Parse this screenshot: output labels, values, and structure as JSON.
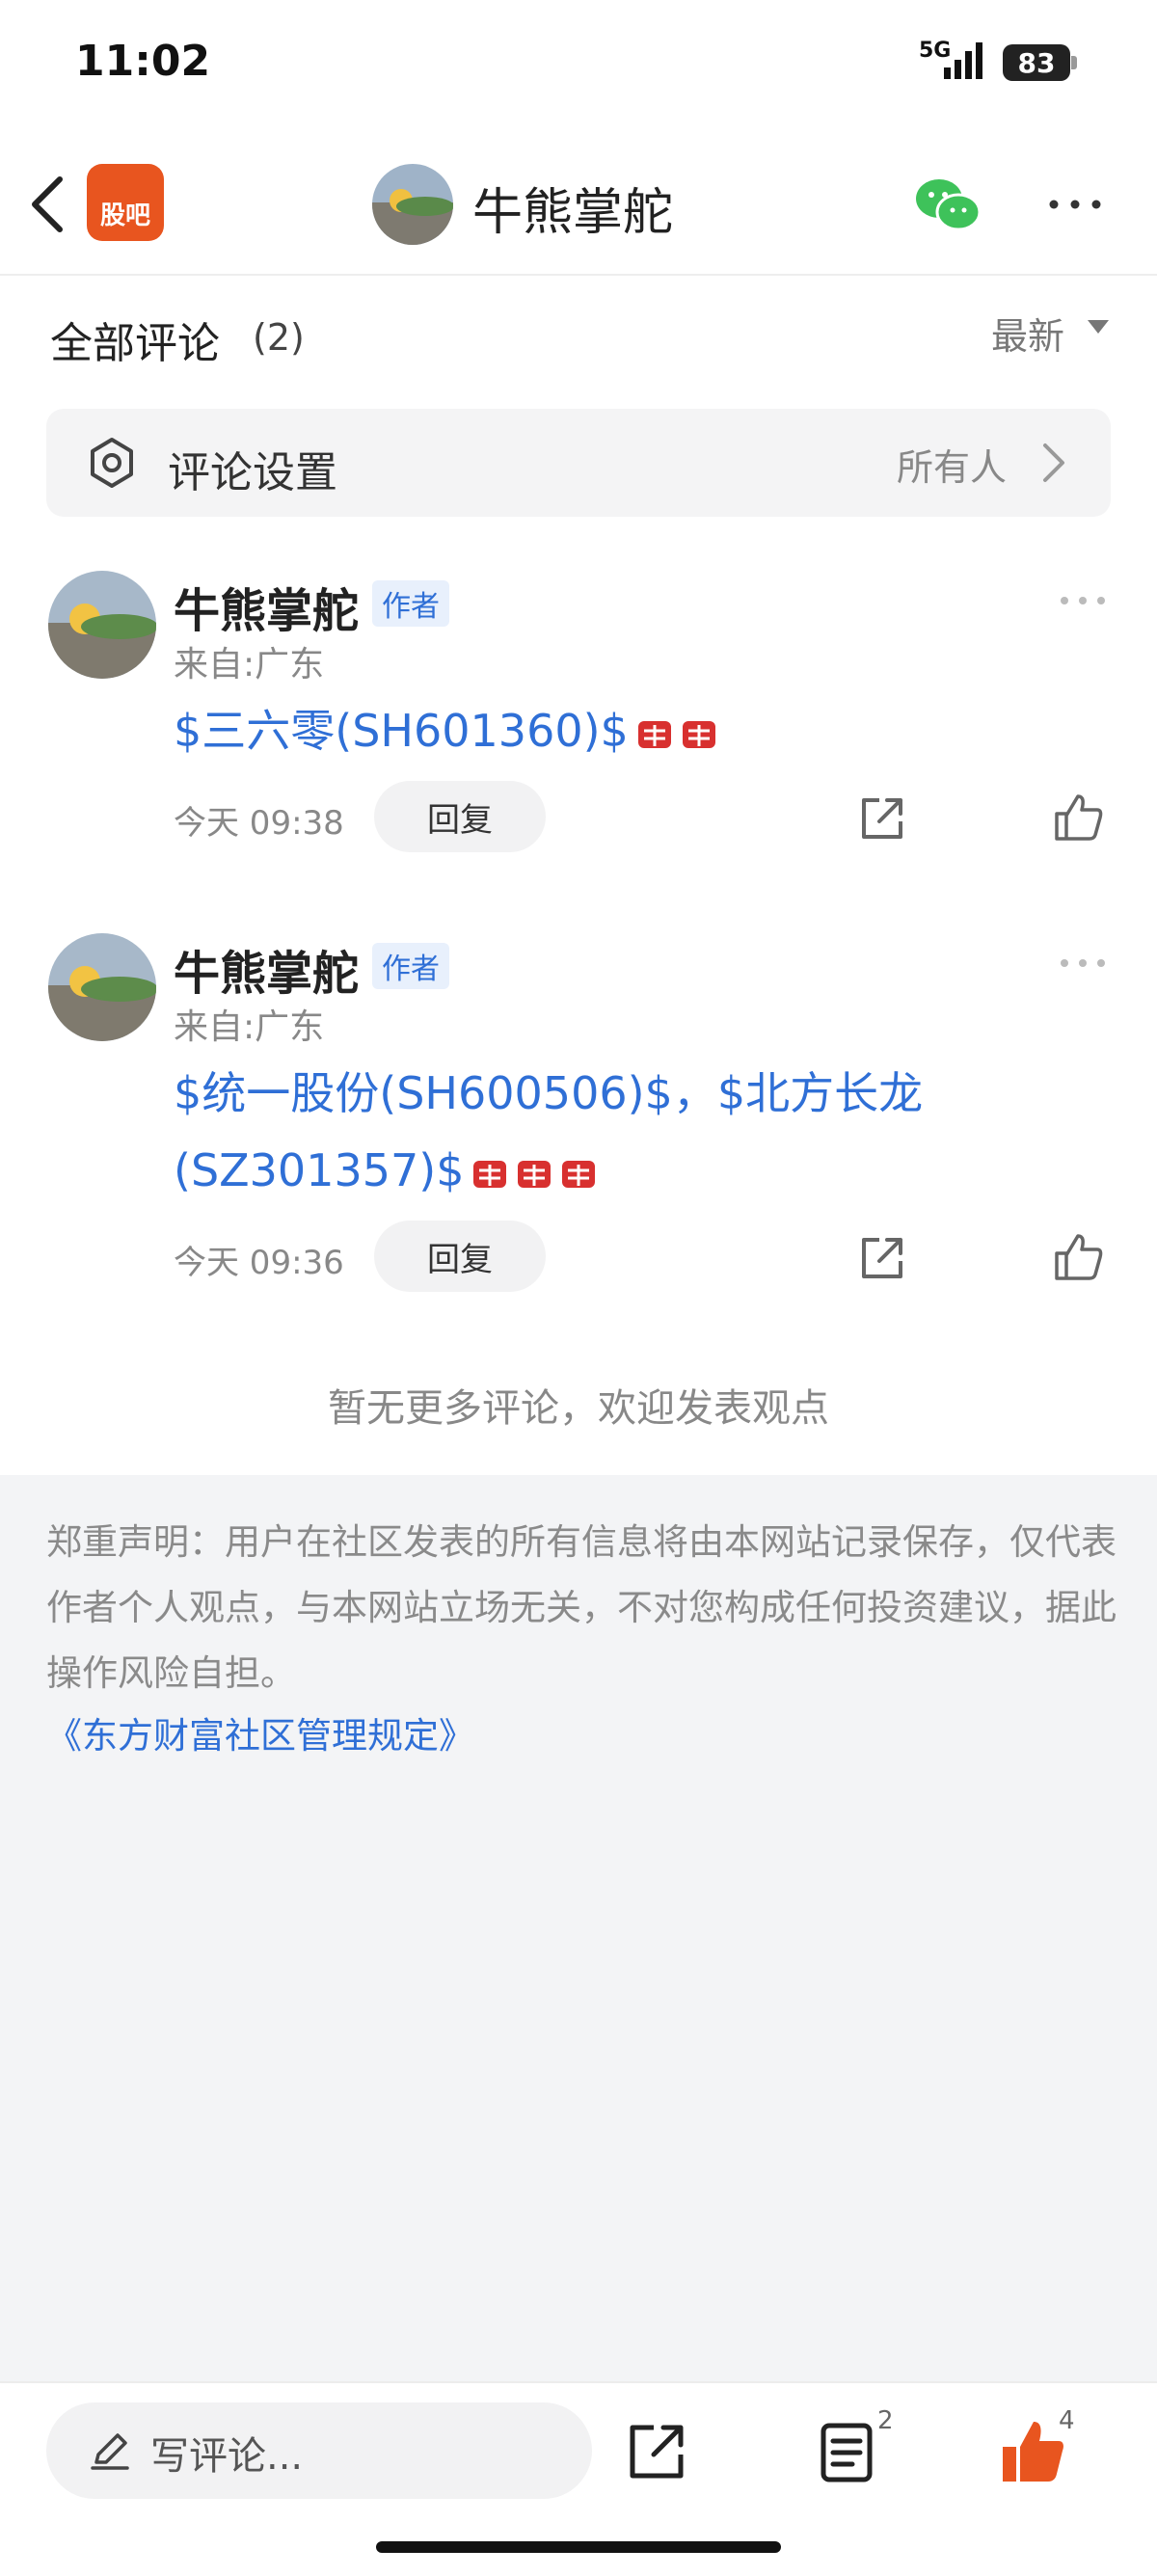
{
  "status": {
    "time": "11:02",
    "network": "5G",
    "battery": "83"
  },
  "nav": {
    "logo_text": "股吧",
    "title": "牛熊掌舵"
  },
  "section": {
    "title": "全部评论",
    "count": "(2)",
    "sort": "最新"
  },
  "settings": {
    "label": "评论设置",
    "value": "所有人"
  },
  "comments": [
    {
      "name": "牛熊掌舵",
      "badge": "作者",
      "from": "来自:广东",
      "text": "$三六零(SH601360)$",
      "time": "今天 09:38",
      "reply": "回复"
    },
    {
      "name": "牛熊掌舵",
      "badge": "作者",
      "from": "来自:广东",
      "text_line1": "$统一股份(SH600506)$，$北方长龙",
      "text_line2": "(SZ301357)$",
      "time": "今天 09:36",
      "reply": "回复"
    }
  ],
  "no_more": "暂无更多评论，欢迎发表观点",
  "disclaimer": "郑重声明：用户在社区发表的所有信息将由本网站记录保存，仅代表作者个人观点，与本网站立场无关，不对您构成任何投资建议，据此操作风险自担。",
  "rules_link": "《东方财富社区管理规定》",
  "bottom": {
    "placeholder": "写评论...",
    "list_count": "2",
    "like_count": "4"
  },
  "colors": {
    "accent_blue": "#2f6fd6",
    "brand_orange": "#e8551f",
    "wechat_green": "#3ec25a"
  }
}
